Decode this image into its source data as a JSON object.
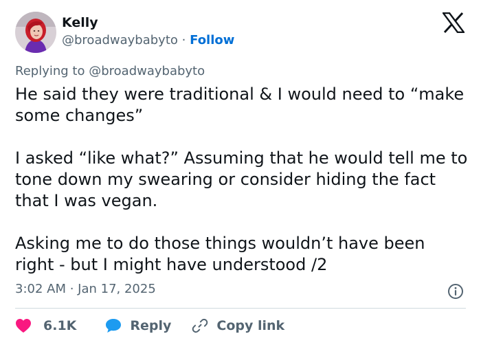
{
  "author": {
    "name": "Kelly",
    "handle": "@broadwaybabyto",
    "separator": "·",
    "follow_label": "Follow",
    "avatar": "avatar-photo-red-hair-purple-top"
  },
  "brand_icon": "x-logo-icon",
  "reply_context": {
    "prefix": "Replying to",
    "mention": "@broadwaybabyto"
  },
  "tweet": {
    "paragraphs": [
      "He said they were traditional & I would need to “make some changes”",
      "I asked “like what?” Assuming that he would tell me to tone down my swearing or consider hiding the fact that I was vegan.",
      "Asking me to do those things wouldn’t have been right - but I might have understood /2"
    ],
    "timestamp": "3:02 AM · Jan 17, 2025",
    "info_icon": "info-icon"
  },
  "actions": {
    "like_count": "6.1K",
    "reply_label": "Reply",
    "copy_link_label": "Copy link",
    "icons": [
      "heart-icon",
      "speech-bubble-icon",
      "link-icon"
    ]
  },
  "colors": {
    "link": "#006fd6",
    "secondary_text": "#536471",
    "heart": "#f91880",
    "reply_bubble": "#1d9bf0",
    "divider": "#cfd9de"
  }
}
